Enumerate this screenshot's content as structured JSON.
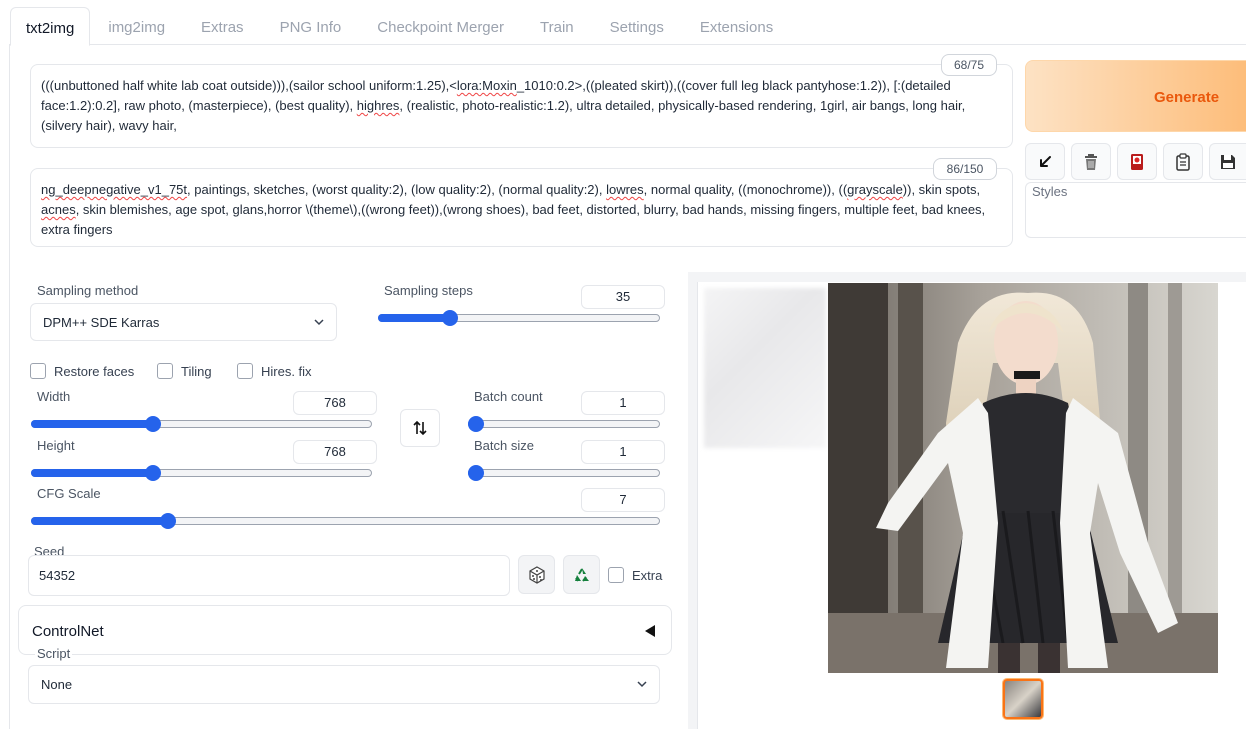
{
  "tabs": [
    "txt2img",
    "img2img",
    "Extras",
    "PNG Info",
    "Checkpoint Merger",
    "Train",
    "Settings",
    "Extensions"
  ],
  "prompt": {
    "counter": "68/75",
    "segments": [
      {
        "t": "(((unbuttoned half white lab coat outside))),(sailor school uniform:1.25),<"
      },
      {
        "t": "lora:Moxin",
        "sq": true
      },
      {
        "t": "_1010:0.2>,((pleated skirt)),((cover full leg black pantyhose:1.2)), [:(detailed face:1.2):0.2], raw photo, (masterpiece), (best quality), "
      },
      {
        "t": "highres",
        "sq": true
      },
      {
        "t": ", (realistic, photo-realistic:1.2), ultra detailed, physically-based rendering, 1girl, air bangs, long hair, (silvery hair), wavy hair,"
      }
    ]
  },
  "negative_prompt": {
    "counter": "86/150",
    "segments": [
      {
        "t": "ng_deepnegative_v1_75t",
        "sq": true
      },
      {
        "t": ", paintings, sketches, (worst quality:2), (low quality:2), (normal quality:2), "
      },
      {
        "t": "lowres",
        "sq": true
      },
      {
        "t": ", normal quality, ((monochrome)), (("
      },
      {
        "t": "grayscale",
        "sq": true
      },
      {
        "t": ")), skin spots, "
      },
      {
        "t": "acnes",
        "sq": true
      },
      {
        "t": ", skin blemishes, age spot, glans,horror \\(theme\\),((wrong feet)),(wrong shoes), bad feet, distorted, blurry, bad hands, missing fingers, multiple feet, bad knees, extra fingers"
      }
    ]
  },
  "generate_label": "Generate",
  "tools": [
    "arrow-icon",
    "trash-icon",
    "card-icon",
    "clipboard-icon",
    "save-icon"
  ],
  "styles_label": "Styles",
  "sampling_method": {
    "label": "Sampling method",
    "value": "DPM++ SDE Karras"
  },
  "sampling_steps": {
    "label": "Sampling steps",
    "value": "35",
    "fraction": 0.24
  },
  "checkboxes": [
    {
      "label": "Restore faces",
      "checked": false
    },
    {
      "label": "Tiling",
      "checked": false
    },
    {
      "label": "Hires. fix",
      "checked": false
    }
  ],
  "width": {
    "label": "Width",
    "value": "768",
    "fraction": 0.35
  },
  "height": {
    "label": "Height",
    "value": "768",
    "fraction": 0.35
  },
  "batch_count": {
    "label": "Batch count",
    "value": "1",
    "fraction": 0.0
  },
  "batch_size": {
    "label": "Batch size",
    "value": "1",
    "fraction": 0.0
  },
  "cfg_scale": {
    "label": "CFG Scale",
    "value": "7",
    "fraction": 0.21
  },
  "seed": {
    "label": "Seed",
    "value": "54352",
    "extra_label": "Extra"
  },
  "controlnet_label": "ControlNet",
  "script": {
    "label": "Script",
    "value": "None"
  },
  "colors": {
    "accent": "#2563eb",
    "generate_text": "#ea580c"
  }
}
